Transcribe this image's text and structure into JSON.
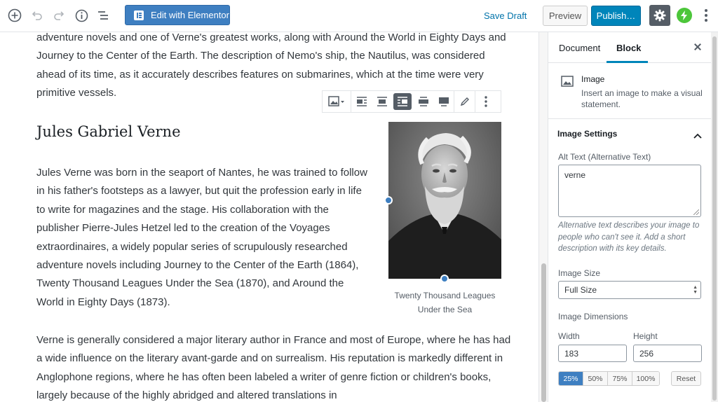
{
  "topbar": {
    "elementor_label": "Edit with Elementor",
    "save_draft_label": "Save Draft",
    "preview_label": "Preview",
    "publish_label": "Publish…",
    "icons": [
      "add-block-icon",
      "undo-icon",
      "redo-icon",
      "info-icon",
      "outline-icon",
      "gear-icon",
      "bolt-icon",
      "more-icon"
    ]
  },
  "editor": {
    "intro_paragraph": "adventure novels and one of Verne's greatest works, along with Around the World in Eighty Days and Journey to the Center of the Earth. The description of Nemo's ship, the Nautilus, was considered ahead of its time, as it accurately describes features on submarines, which at the time were very primitive vessels.",
    "heading": "Jules Gabriel Verne",
    "born_paragraph": "Jules Verne was born in the seaport of Nantes, he was trained to follow in his father's footsteps as a lawyer, but quit the profession early in life to write for magazines and the stage. His collaboration with the publisher Pierre-Jules Hetzel led to the creation of the Voyages extraordinaires, a widely popular series of scrupulously researched adventure novels including Journey to the Center of the Earth (1864), Twenty Thousand Leagues Under the Sea (1870), and Around the World in Eighty Days (1873).",
    "verne_paragraph": "Verne is generally considered a major literary author in France and most of Europe, where he has had a wide influence on the literary avant-garde and on surrealism. His reputation is markedly different in Anglophone regions, where he has often been labeled a writer of genre fiction or children's books, largely because of the highly abridged and altered translations in",
    "image_caption": "Twenty Thousand Leagues Under the Sea",
    "block_toolbar_icons": [
      "image-type-icon",
      "align-left-icon",
      "align-center-icon",
      "align-right-icon",
      "wide-width-icon",
      "full-width-icon",
      "edit-pencil-icon",
      "more-options-icon"
    ]
  },
  "sidebar": {
    "tab_document": "Document",
    "tab_block": "Block",
    "block_name": "Image",
    "block_description": "Insert an image to make a visual statement.",
    "panel_title": "Image Settings",
    "alt_label": "Alt Text (Alternative Text)",
    "alt_value": "verne",
    "alt_help": "Alternative text describes your image to people who can't see it. Add a short description with its key details.",
    "size_label": "Image Size",
    "size_value": "Full Size",
    "dimensions_label": "Image Dimensions",
    "width_label": "Width",
    "height_label": "Height",
    "width_value": "183",
    "height_value": "256",
    "percent_options": [
      "25%",
      "50%",
      "75%",
      "100%"
    ],
    "selected_percent": "25%",
    "reset_label": "Reset"
  },
  "colors": {
    "accent": "#0085ba",
    "elementor_blue": "#3e7fc1",
    "bolt_green": "#4cc63a"
  }
}
